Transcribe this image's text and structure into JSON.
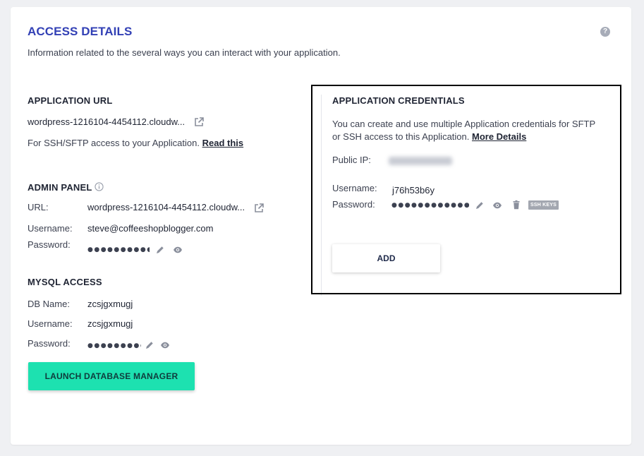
{
  "header": {
    "title": "ACCESS DETAILS",
    "subtitle": "Information related to the several ways you can interact with your application.",
    "help_glyph": "?"
  },
  "application_url": {
    "heading": "APPLICATION URL",
    "url": "wordpress-1216104-4454112.cloudw...",
    "ssh_note": "For SSH/SFTP access to your Application.",
    "read_this": "Read this"
  },
  "admin_panel": {
    "heading": "ADMIN PANEL",
    "url_label": "URL:",
    "url": "wordpress-1216104-4454112.cloudw...",
    "username_label": "Username:",
    "username": "steve@coffeeshopblogger.com",
    "password_label": "Password:",
    "password_mask": "●●●●●●●●●●"
  },
  "mysql": {
    "heading": "MYSQL ACCESS",
    "db_label": "DB Name:",
    "db_name": "zcsjgxmugj",
    "username_label": "Username:",
    "username": "zcsjgxmugj",
    "password_label": "Password:",
    "password_mask": "●●●●●●●●●●●",
    "launch_button": "LAUNCH DATABASE MANAGER"
  },
  "app_credentials": {
    "heading": "APPLICATION CREDENTIALS",
    "desc_line1": "You can create and use multiple Application credentials for SFTP",
    "desc_line2": "or SSH access to this Application.",
    "more_details": "More Details",
    "public_ip_label": "Public IP:",
    "username_label": "Username:",
    "username": "j76h53b6y",
    "password_label": "Password:",
    "password_mask": "●●●●●●●●●●●●",
    "ssh_keys": "SSH KEYS",
    "add_button": "ADD"
  },
  "icons": {
    "external": "external-link-icon",
    "info": "info-icon",
    "edit": "pencil-icon",
    "view": "eye-icon",
    "delete": "trash-icon",
    "help": "help-icon"
  },
  "colors": {
    "title": "#3240b5",
    "launch_button": "#1de1b0",
    "highlight_border": "#000000"
  }
}
